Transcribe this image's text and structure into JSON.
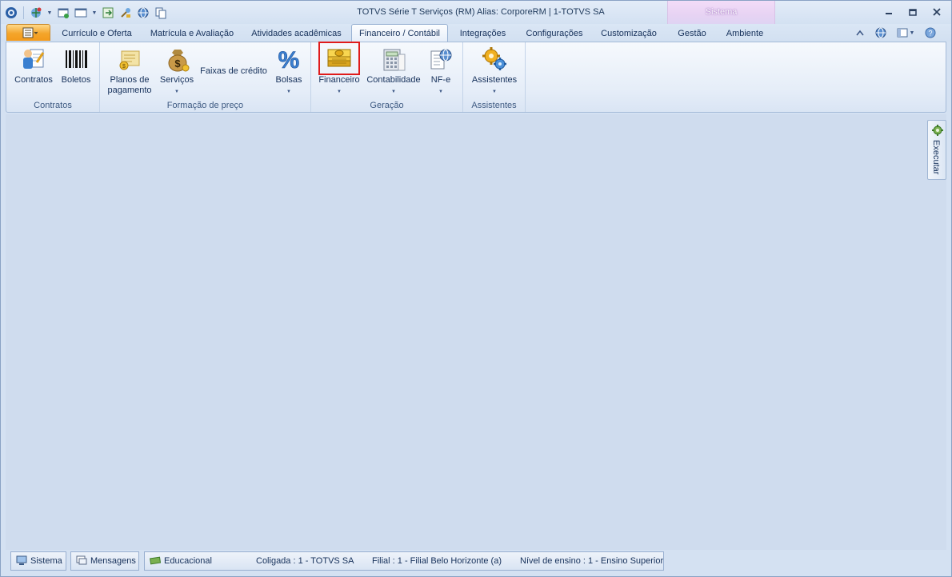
{
  "window": {
    "title": "TOTVS Série T Serviços (RM) Alias: CorporeRM | 1-TOTVS SA",
    "context_tab": "Sistema"
  },
  "tabs": [
    {
      "label": "Currículo e Oferta"
    },
    {
      "label": "Matrícula e Avaliação"
    },
    {
      "label": "Atividades acadêmicas"
    },
    {
      "label": "Financeiro / Contábil",
      "active": true
    },
    {
      "label": "Integrações"
    },
    {
      "label": "Configurações"
    },
    {
      "label": "Customização"
    },
    {
      "label": "Gestão"
    },
    {
      "label": "Ambiente"
    }
  ],
  "ribbon": {
    "groups": {
      "contratos": {
        "label": "Contratos",
        "buttons": {
          "contratos": "Contratos",
          "boletos": "Boletos"
        }
      },
      "formacao": {
        "label": "Formação de preço",
        "buttons": {
          "planos_line1": "Planos de",
          "planos_line2": "pagamento",
          "servicos": "Serviços",
          "faixas": "Faixas de crédito",
          "bolsas": "Bolsas"
        }
      },
      "geracao": {
        "label": "Geração",
        "buttons": {
          "financeiro": "Financeiro",
          "contabilidade": "Contabilidade",
          "nfe": "NF-e"
        }
      },
      "assistentes": {
        "label": "Assistentes",
        "buttons": {
          "assistentes": "Assistentes"
        }
      }
    }
  },
  "side_panel": {
    "label": "Executar"
  },
  "statusbar": {
    "sistema": "Sistema",
    "mensagens": "Mensagens",
    "educacional": "Educacional",
    "coligada": "Coligada : 1 - TOTVS SA",
    "filial": "Filial : 1 - Filial Belo Horizonte (a)",
    "nivel": "Nível de ensino : 1 - Ensino Superior"
  },
  "colors": {
    "accent_orange": "#f4a52a",
    "highlight_red": "#e01b1b",
    "context_tab_pink": "#e7d3f3"
  }
}
